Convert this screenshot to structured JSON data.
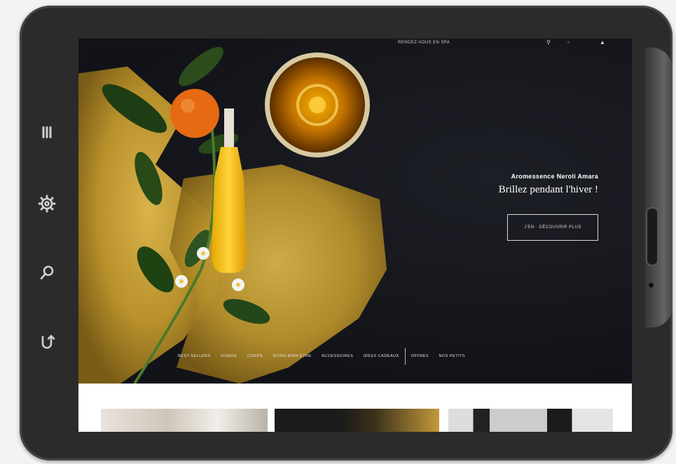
{
  "colors": {
    "accent_gold": "#c9a227",
    "hero_bg": "#15161b",
    "tablet_frame": "#2b2b2b"
  },
  "sidebar": {
    "items": [
      {
        "icon": "menu-icon"
      },
      {
        "icon": "gear-icon"
      },
      {
        "icon": "search-icon"
      },
      {
        "icon": "undo-icon"
      }
    ]
  },
  "topbar": {
    "link": "RENDEZ-VOUS EN SPA"
  },
  "hero": {
    "kicker": "Aromessence Neroli Amara",
    "title": "Brillez pendant l'hiver !",
    "cta": "J'EN · DÉCOUVRIR PLUS"
  },
  "categories": [
    "BEST-SELLERS",
    "VISAGE",
    "CORPS",
    "SOINS BIEN-ÊTRE",
    "ACCESSOIRES",
    "IDÉES CADEAUX",
    "OFFRES",
    "NOS PETITS"
  ]
}
